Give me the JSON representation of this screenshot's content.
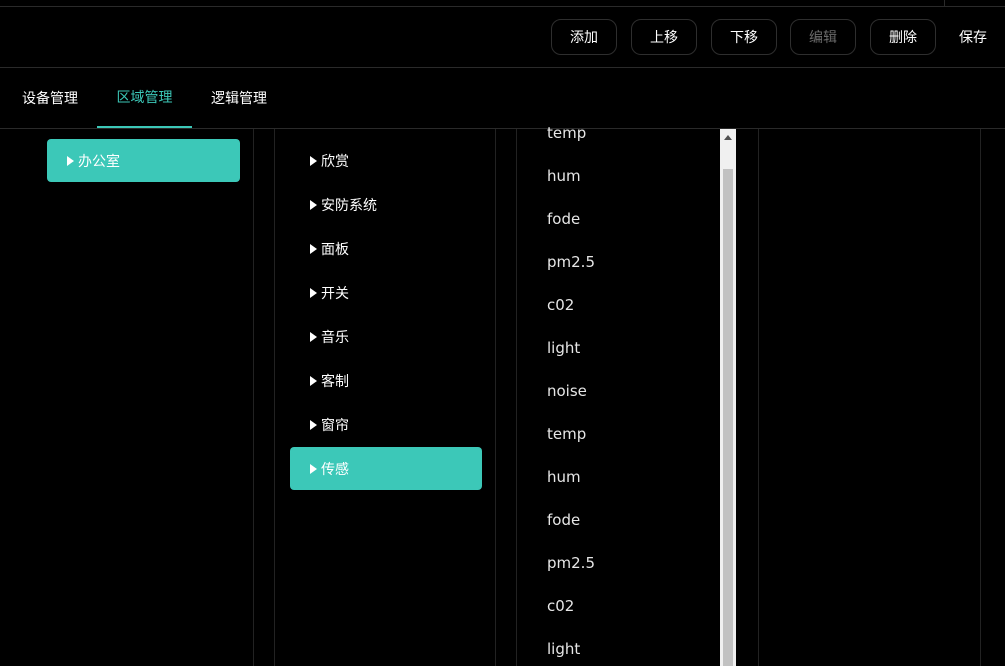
{
  "toolbar": {
    "add_label": "添加",
    "move_up_label": "上移",
    "move_down_label": "下移",
    "edit_label": "编辑",
    "delete_label": "删除",
    "save_label": "保存"
  },
  "tabs": [
    {
      "label": "设备管理"
    },
    {
      "label": "区域管理"
    },
    {
      "label": "逻辑管理"
    }
  ],
  "areas": [
    {
      "label": "办公室"
    }
  ],
  "categories": [
    {
      "label": "欣赏"
    },
    {
      "label": "安防系统"
    },
    {
      "label": "面板"
    },
    {
      "label": "开关"
    },
    {
      "label": "音乐"
    },
    {
      "label": "客制"
    },
    {
      "label": "窗帘"
    },
    {
      "label": "传感"
    }
  ],
  "sensors": [
    "temp",
    "hum",
    "fode",
    "pm2.5",
    "c02",
    "light",
    "noise",
    "temp",
    "hum",
    "fode",
    "pm2.5",
    "c02",
    "light"
  ],
  "colors": {
    "accent": "#3cc8b8",
    "background": "#000000",
    "disabled_text": "#6a6a6a"
  },
  "state": {
    "active_tab": "区域管理",
    "selected_area": "办公室",
    "selected_category": "传感"
  }
}
